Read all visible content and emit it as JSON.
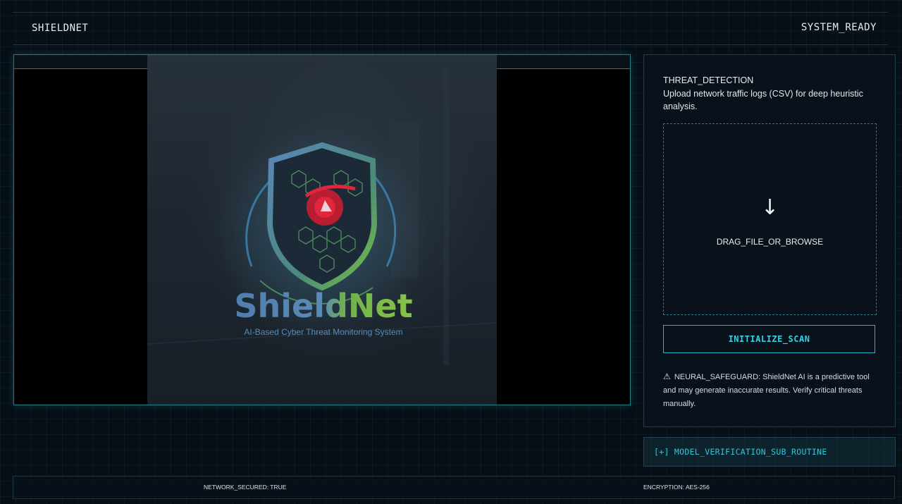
{
  "header": {
    "brand": "SHIELDNET",
    "status": "SYSTEM_READY"
  },
  "viewer": {
    "logo_title": "ShieldNet",
    "logo_subtitle": "AI-Based Cyber Threat Monitoring System"
  },
  "panel": {
    "title": "THREAT_DETECTION",
    "description": "Upload network traffic logs (CSV) for deep heuristic analysis.",
    "dropzone": {
      "icon": "download-arrow-icon",
      "icon_glyph": "↓",
      "label": "DRAG_FILE_OR_BROWSE"
    },
    "scan_button": "INITIALIZE_SCAN",
    "warning_icon": "⚠",
    "warning": "NEURAL_SAFEGUARD: ShieldNet AI is a predictive tool and may generate inaccurate results. Verify critical threats manually."
  },
  "subroutine": {
    "label": "[+] MODEL_VERIFICATION_SUB_ROUTINE"
  },
  "footer": {
    "network": "NETWORK_SECURED: TRUE",
    "encryption": "ENCRYPTION: AES-256"
  },
  "colors": {
    "accent": "#30d3e6",
    "background": "#070e16",
    "logo_red": "#d2243a",
    "logo_green": "#7bc142",
    "logo_blue": "#4d78a8"
  }
}
